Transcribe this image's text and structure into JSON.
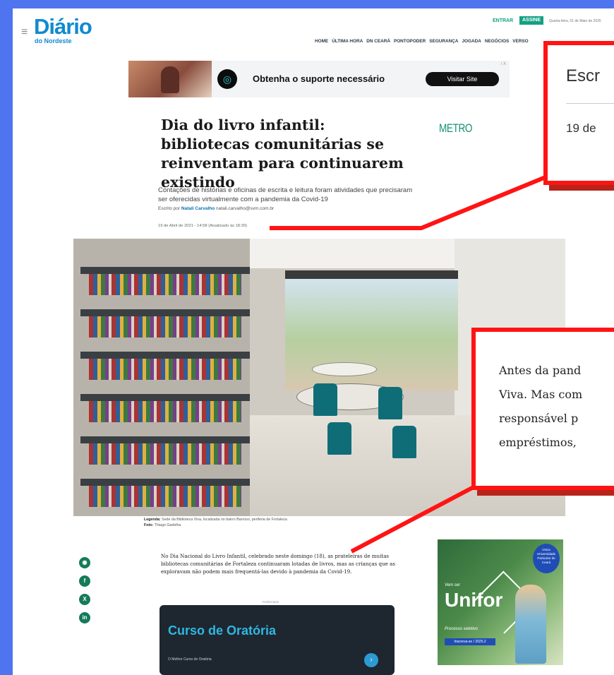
{
  "header": {
    "menu_icon": "hamburger-icon",
    "logo_main": "Diário",
    "logo_sub": "do Nordeste",
    "entrar": "ENTRAR",
    "assine": "ASSINE",
    "date": "Quarta-feira, 01 de Maio de 2025",
    "nav": [
      "HOME",
      "ÚLTIMA HORA",
      "DN CEARÁ",
      "PONTOPODER",
      "SEGURANÇA",
      "JOGADA",
      "NEGÓCIOS",
      "VERSO"
    ]
  },
  "ad_banner": {
    "text": "Obtenha o suporte necessário",
    "button": "Visitar Site",
    "badge": "i X"
  },
  "article": {
    "title": "Dia do livro infantil: bibliotecas comunitárias se reinventam para continuarem existindo",
    "section": "METRO",
    "subtitle": "Contações de histórias e oficinas de escrita e leitura foram atividades que precisaram ser oferecidas virtualmente com a pandemia da Covid-19",
    "byline_prefix": "Escrito por",
    "author": "Natali Carvalho",
    "author_email": "natali.carvalho@svm.com.br",
    "datetime": "19 de Abril de 2021 - 14:58 (Atualizado às 18:39)",
    "legend_label": "Legenda:",
    "legend_text": "Sede da Biblioteca Viva, localizada no bairro Barroso, periferia de Fortaleza",
    "photo_label": "Foto:",
    "photo_credit": "Thiago Gadelha",
    "body": "No Dia Nacional do Livro Infantil, celebrado neste domingo (18), as prateleiras de muitas bibliotecas comunitárias de Fortaleza continuaram lotadas de livros, mas as crianças que as exploravam não podem mais frequentá-las devido à pandemia da Covid-19."
  },
  "share": [
    "whatsapp-icon",
    "facebook-icon",
    "x-icon",
    "linkedin-icon"
  ],
  "share_glyphs": [
    "◉",
    "f",
    "X",
    "in"
  ],
  "ad_course": {
    "label": "Publicidade",
    "title": "Curso de Oratória",
    "subtitle": "O Melhor Curso de Oratória",
    "arrow": "›"
  },
  "ad_unifor": {
    "badge": "Única Universidade Particular do Ceará",
    "vem": "Vem ser",
    "brand": "Unifor",
    "process": "Processo seletivo",
    "cta": "Inscreva-se / 2025.2"
  },
  "zoom_callouts": {
    "top_line1": "Escr",
    "top_line2": "19 de",
    "body_lines": [
      "Antes da pand",
      "Viva. Mas com",
      "responsável p",
      "empréstimos,"
    ]
  },
  "colors": {
    "brand": "#0f8ad0",
    "accent_green": "#14a085",
    "callout_red": "#ff1414",
    "frame_blue": "#4f74f0"
  }
}
